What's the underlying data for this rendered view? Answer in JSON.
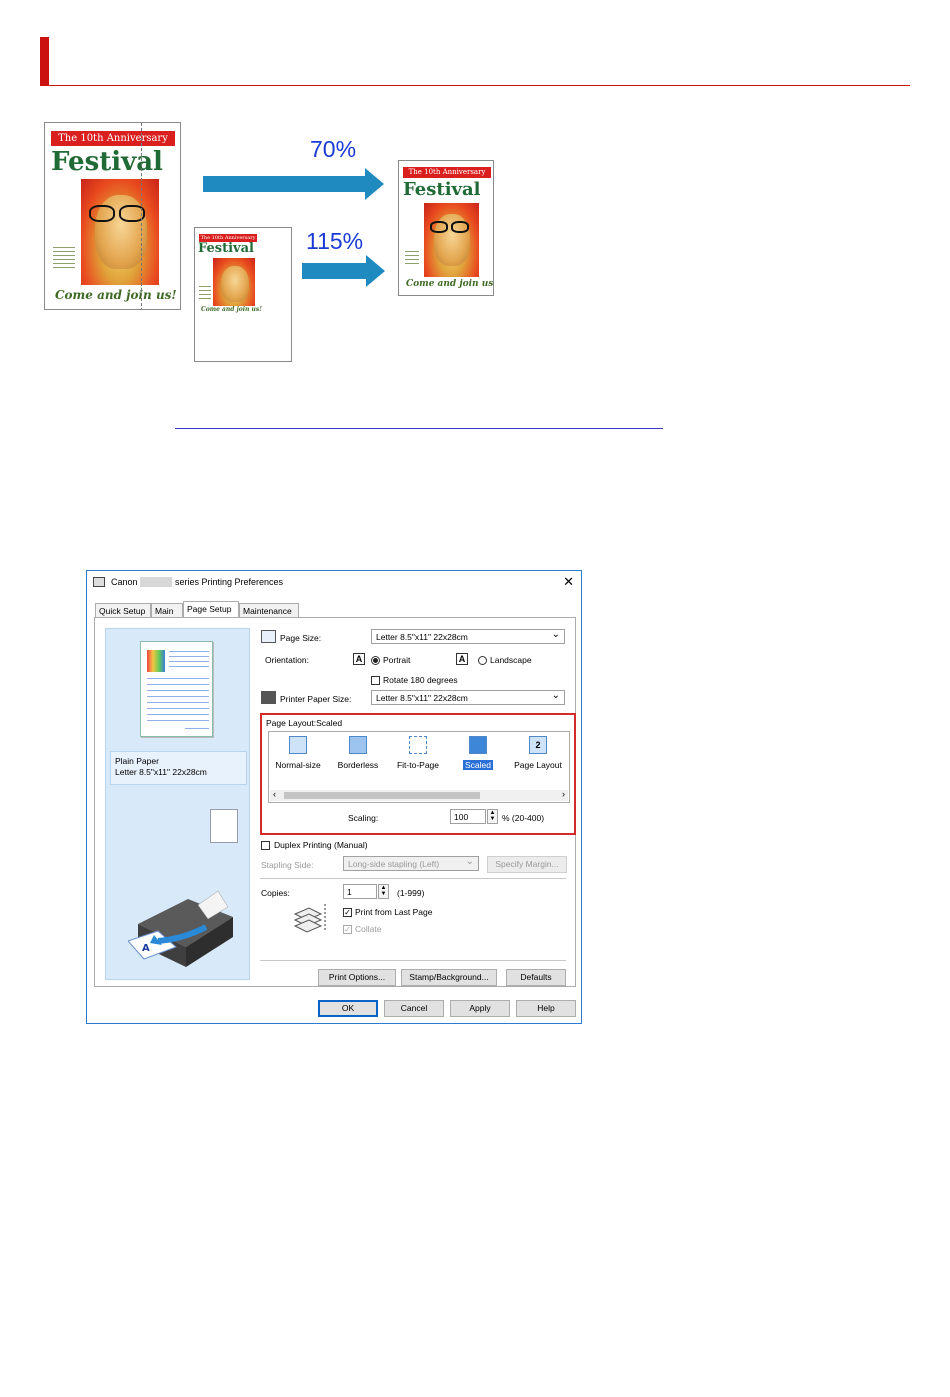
{
  "illustration": {
    "poster": {
      "banner": "The 10th Anniversary",
      "title": "Festival",
      "slogan": "Come and join us!"
    },
    "scale_down_label": "70%",
    "scale_up_label": "115%"
  },
  "dialog": {
    "title_prefix": "Canon",
    "title_suffix": "series Printing Preferences",
    "close": "✕",
    "tabs": [
      "Quick Setup",
      "Main",
      "Page Setup",
      "Maintenance"
    ],
    "active_tab": "Page Setup",
    "preview": {
      "media_type": "Plain Paper",
      "media_size": "Letter 8.5\"x11\" 22x28cm"
    },
    "page_size": {
      "label": "Page Size:",
      "value": "Letter 8.5\"x11\" 22x28cm"
    },
    "orientation": {
      "label": "Orientation:",
      "portrait": "Portrait",
      "landscape": "Landscape",
      "selected": "Portrait",
      "rotate_label": "Rotate 180 degrees",
      "rotate_checked": false
    },
    "printer_paper_size": {
      "label": "Printer Paper Size:",
      "value": "Letter 8.5\"x11\" 22x28cm"
    },
    "page_layout": {
      "label": "Page Layout:Scaled",
      "items": [
        "Normal-size",
        "Borderless",
        "Fit-to-Page",
        "Scaled",
        "Page Layout"
      ],
      "selected": "Scaled",
      "page_layout_icon_text": "2"
    },
    "scaling": {
      "label": "Scaling:",
      "value": "100",
      "range": "% (20-400)"
    },
    "duplex": {
      "label": "Duplex Printing (Manual)",
      "checked": false
    },
    "stapling": {
      "label": "Stapling Side:",
      "value": "Long-side stapling (Left)",
      "margin_button": "Specify Margin..."
    },
    "copies": {
      "label": "Copies:",
      "value": "1",
      "range": "(1-999)",
      "print_from_last": "Print from Last Page",
      "print_from_last_checked": true,
      "collate": "Collate",
      "collate_checked": true
    },
    "buttons": {
      "print_options": "Print Options...",
      "stamp_background": "Stamp/Background...",
      "defaults": "Defaults",
      "ok": "OK",
      "cancel": "Cancel",
      "apply": "Apply",
      "help": "Help"
    },
    "checkmark": "✓",
    "arrow_left": "‹",
    "arrow_right": "›",
    "spin_up": "▲",
    "spin_down": "▼"
  }
}
